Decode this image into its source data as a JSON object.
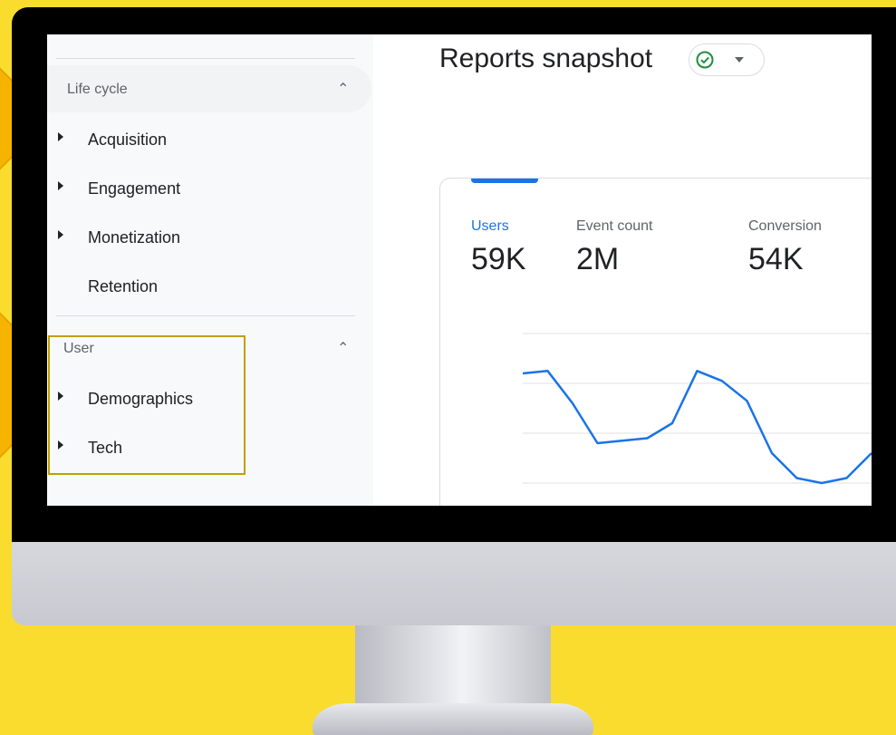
{
  "sidebar": {
    "sections": [
      {
        "title": "Life cycle",
        "items": [
          {
            "label": "Acquisition",
            "expandable": true
          },
          {
            "label": "Engagement",
            "expandable": true
          },
          {
            "label": "Monetization",
            "expandable": true
          },
          {
            "label": "Retention",
            "expandable": false
          }
        ]
      },
      {
        "title": "User",
        "items": [
          {
            "label": "Demographics",
            "expandable": true
          },
          {
            "label": "Tech",
            "expandable": true
          }
        ]
      }
    ]
  },
  "main": {
    "title": "Reports snapshot",
    "metrics": [
      {
        "label": "Users",
        "value": "59K",
        "active": true
      },
      {
        "label": "Event count",
        "value": "2M",
        "active": false
      },
      {
        "label": "Conversion",
        "value": "54K",
        "active": false
      }
    ]
  },
  "colors": {
    "accent": "#1a73e8",
    "status_ok": "#1e8e3e",
    "background": "#f9dc2e",
    "callout": "#f6b400"
  },
  "chart_data": {
    "type": "line",
    "x": [
      1,
      2,
      3,
      4,
      5,
      6,
      7,
      8,
      9,
      10,
      11,
      12,
      13,
      14,
      15
    ],
    "series": [
      {
        "values": [
          3.2,
          3.25,
          2.6,
          1.8,
          1.85,
          1.9,
          2.2,
          3.25,
          3.05,
          2.65,
          1.6,
          1.1,
          1.0,
          1.1,
          1.6
        ]
      }
    ],
    "ylim": [
      0,
      4
    ],
    "grid": true
  }
}
